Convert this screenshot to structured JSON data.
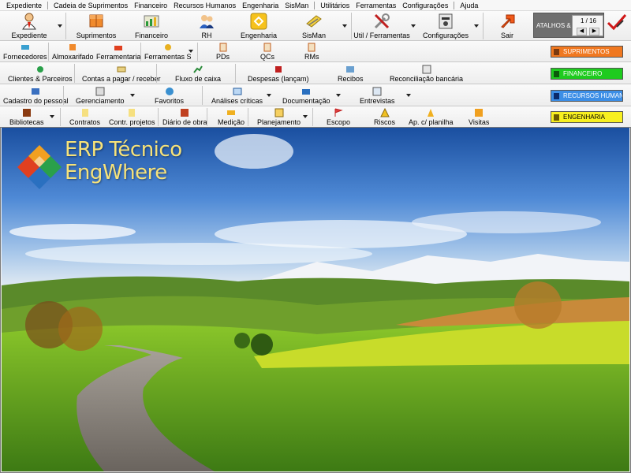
{
  "menu": [
    "Expediente",
    "Cadeia de Suprimentos",
    "Financeiro",
    "Recursos Humanos",
    "Engenharia",
    "SisMan",
    "Utilitários",
    "Ferramentas",
    "Configurações",
    "Ajuda"
  ],
  "toolbar_main": {
    "expediente": "Expediente",
    "suprimentos": "Suprimentos",
    "financeiro": "Financeiro",
    "rh": "RH",
    "engenharia": "Engenharia",
    "sisman": "SisMan",
    "util": "Util / Ferramentas",
    "config": "Configurações",
    "sair": "Sair"
  },
  "atalhos": {
    "label": "ATALHOS &",
    "page": "1 / 16",
    "prev": "◀",
    "next": "▶"
  },
  "row_suprimentos": {
    "fornecedores": "Fornecedores",
    "almoxarifado": "Almoxarifado",
    "ferramentaria": "Ferramentaria",
    "ferramentas_s": "Ferramentas S",
    "pds": "PDs",
    "qcs": "QCs",
    "rms": "RMs",
    "module": "SUPRIMENTOS"
  },
  "row_financeiro": {
    "clientes": "Clientes & Parceiros",
    "contas": "Contas a pagar / receber",
    "fluxo": "Fluxo de caixa",
    "despesas": "Despesas (lançam)",
    "recibos": "Recibos",
    "conciliacao": "Reconciliação bancária",
    "module": "FINANCEIRO"
  },
  "row_rh": {
    "cadastro": "Cadastro do pessoal",
    "gerenciamento": "Gerenciamento",
    "favoritos": "Favoritos",
    "analises": "Análises críticas",
    "documentacao": "Documentação",
    "entrevistas": "Entrevistas",
    "module": "RECURSOS HUMANOS"
  },
  "row_engenharia": {
    "bibliotecas": "Bibliotecas",
    "contratos": "Contratos",
    "projetos": "Contr. projetos",
    "diario": "Diário de obra",
    "medicao": "Medição",
    "planejamento": "Planejamento",
    "escopo": "Escopo",
    "riscos": "Riscos",
    "apc": "Ap. c/ planilha",
    "visitas": "Visitas",
    "module": "ENGENHARIA"
  },
  "logo": {
    "line1": "ERP Técnico",
    "line2": "EngWhere"
  },
  "colors": {
    "suprimentos": "#f07820",
    "financeiro": "#1ecb1e",
    "rh": "#3c8ee6",
    "engenharia": "#f8f020",
    "logo_text": "#f6e27a"
  }
}
